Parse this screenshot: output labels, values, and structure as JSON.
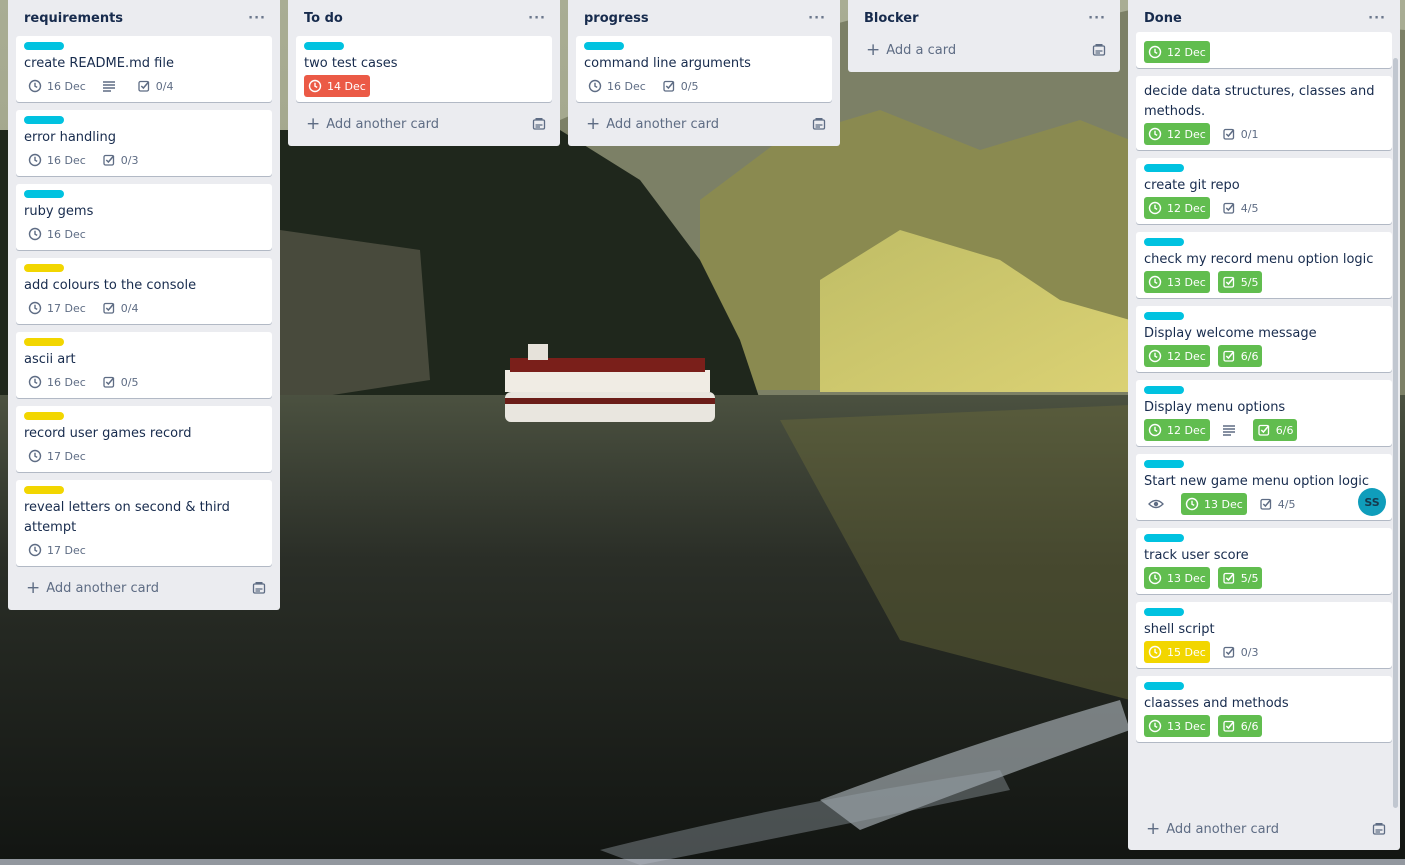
{
  "colors": {
    "label_cyan": "#00c2e0",
    "label_yellow": "#f2d600",
    "due_green": "#61bd4f",
    "due_red": "#eb5a46",
    "due_yellow": "#f2d600",
    "list_bg": "#ebecf0"
  },
  "icons": {
    "clock": "clock-icon",
    "checklist": "checklist-icon",
    "description": "description-icon",
    "watch": "eye-icon",
    "template": "card-template-icon",
    "menu": "ellipsis-icon",
    "add": "plus-icon"
  },
  "lists": [
    {
      "title": "requirements",
      "menu": "···",
      "add_label": "Add another card",
      "cards": [
        {
          "label": "cyan",
          "title": "create README.md file",
          "due": "16 Dec",
          "due_style": "plain",
          "description": true,
          "checklist": "0/4"
        },
        {
          "label": "cyan",
          "title": "error handling",
          "due": "16 Dec",
          "due_style": "plain",
          "checklist": "0/3"
        },
        {
          "label": "cyan",
          "title": "ruby gems",
          "due": "16 Dec",
          "due_style": "plain"
        },
        {
          "label": "yellow",
          "title": "add colours to the console",
          "due": "17 Dec",
          "due_style": "plain",
          "checklist": "0/4"
        },
        {
          "label": "yellow",
          "title": "ascii art",
          "due": "16 Dec",
          "due_style": "plain",
          "checklist": "0/5"
        },
        {
          "label": "yellow",
          "title": "record user games record",
          "due": "17 Dec",
          "due_style": "plain"
        },
        {
          "label": "yellow",
          "title": "reveal letters on second & third attempt",
          "due": "17 Dec",
          "due_style": "plain"
        }
      ]
    },
    {
      "title": "To do",
      "menu": "···",
      "add_label": "Add another card",
      "cards": [
        {
          "label": "cyan",
          "title": "two test cases",
          "due": "14 Dec",
          "due_style": "red"
        }
      ]
    },
    {
      "title": "progress",
      "menu": "···",
      "add_label": "Add another card",
      "cards": [
        {
          "label": "cyan",
          "title": "command line arguments",
          "due": "16 Dec",
          "due_style": "plain",
          "checklist": "0/5"
        }
      ]
    },
    {
      "title": "Blocker",
      "menu": "···",
      "add_label": "Add a card",
      "cards": []
    },
    {
      "title": "Done",
      "menu": "···",
      "add_label": "Add another card",
      "cards": [
        {
          "label": "none",
          "title": "",
          "due": "12 Dec",
          "due_style": "green"
        },
        {
          "label": "none",
          "title": "decide data structures, classes and methods.",
          "due": "12 Dec",
          "due_style": "green",
          "checklist": "0/1"
        },
        {
          "label": "cyan",
          "title": "create git repo",
          "due": "12 Dec",
          "due_style": "green",
          "checklist": "4/5"
        },
        {
          "label": "cyan",
          "title": "check my record menu option logic",
          "due": "13 Dec",
          "due_style": "green",
          "checklist": "5/5",
          "checklist_complete": true
        },
        {
          "label": "cyan",
          "title": "Display welcome message",
          "due": "12 Dec",
          "due_style": "green",
          "checklist": "6/6",
          "checklist_complete": true
        },
        {
          "label": "cyan",
          "title": "Display menu options",
          "due": "12 Dec",
          "due_style": "green",
          "description": true,
          "checklist": "6/6",
          "checklist_complete": true
        },
        {
          "label": "cyan",
          "title": "Start new game menu option logic",
          "watch": true,
          "due": "13 Dec",
          "due_style": "green",
          "checklist": "4/5",
          "member": "SS"
        },
        {
          "label": "cyan",
          "title": "track user score",
          "due": "13 Dec",
          "due_style": "green",
          "checklist": "5/5",
          "checklist_complete": true
        },
        {
          "label": "cyan",
          "title": "shell script",
          "due": "15 Dec",
          "due_style": "yellow",
          "checklist": "0/3"
        },
        {
          "label": "cyan",
          "title": "claasses and methods",
          "due": "13 Dec",
          "due_style": "green",
          "checklist": "6/6",
          "checklist_complete": true
        }
      ]
    }
  ]
}
